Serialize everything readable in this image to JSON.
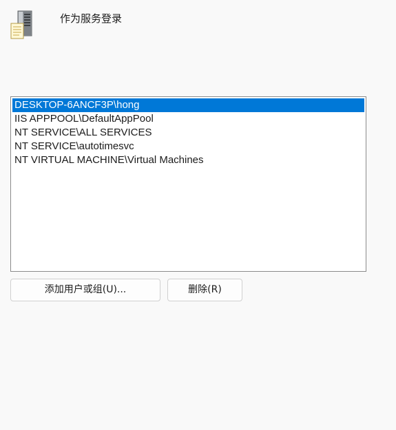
{
  "header": {
    "icon": "server-computer-icon",
    "title": "作为服务登录"
  },
  "members": {
    "items": [
      {
        "label": "DESKTOP-6ANCF3P\\hong",
        "selected": true
      },
      {
        "label": "IIS APPPOOL\\DefaultAppPool",
        "selected": false
      },
      {
        "label": "NT SERVICE\\ALL SERVICES",
        "selected": false
      },
      {
        "label": "NT SERVICE\\autotimesvc",
        "selected": false
      },
      {
        "label": "NT VIRTUAL MACHINE\\Virtual Machines",
        "selected": false
      }
    ]
  },
  "buttons": {
    "add_label": "添加用户或组(U)...",
    "remove_label": "删除(R)"
  },
  "colors": {
    "selection": "#0078d7",
    "background": "#f9f9f9"
  }
}
